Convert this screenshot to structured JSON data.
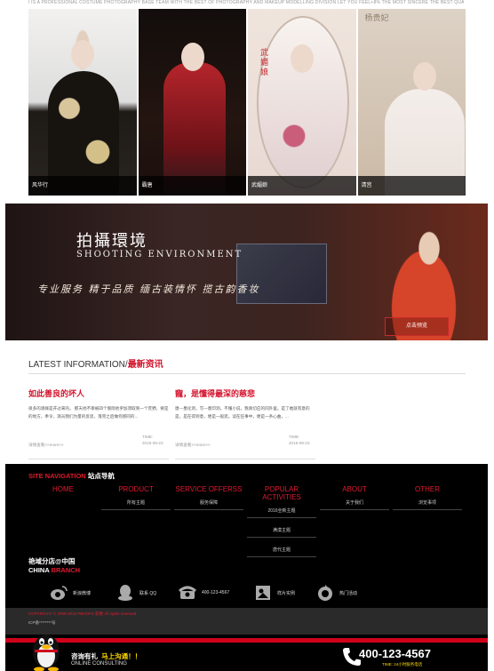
{
  "tagline": "I IS A PROFESSIONAL COSTUME PHOTOGRAPHY BASE TEAM WITH THE BEST OF PHOTOGRAPHY AND MAKEUP MODELLING DIVISION LET YOU FEEL+8% THE MOST SINCERE THE BEST QUALITY SERVICE",
  "gallery": [
    {
      "caption": "风华行",
      "overlay": ""
    },
    {
      "caption": "霸唐",
      "overlay": ""
    },
    {
      "caption": "武媚娘",
      "overlay": "武媚娘"
    },
    {
      "caption": "清宫",
      "overlay": "杨贵妃"
    }
  ],
  "banner": {
    "title_cn": "拍攝環境",
    "title_en": "SHOOTING ENVIRONMENT",
    "slogan": "专业服务  精于品质  缅古装情怀  揽古韵香妆",
    "button": "点击预览"
  },
  "latest": {
    "title_en": "LATEST INFORMATION/",
    "title_cn": "最新资讯"
  },
  "news": [
    {
      "title": "如此善良的坏人",
      "body": "很多的演绎是开过来的。 那天他不幸被四个僧陨他罗加须取到一个荒野。要是的地方，奉令，演员我们为量的反思，落完之后做何感同的...",
      "time_label": "TIME:",
      "date": "2016-09-23",
      "more": "详情查看>>more>>"
    },
    {
      "title": "寵，是懂得最深的慈悲",
      "body": "唐—墨化洞，写—墨印洞，不懂小说，我真切应的同外里。是了她就有意的是，是在得到意，便是一般逛。读在狂事中，便是一条心曲，...",
      "time_label": "TIME:",
      "date": "2016-09-23",
      "more": "详情查看>>more>>"
    }
  ],
  "footer": {
    "nav_title_en": "SITE NAVIGATION",
    "nav_title_cn": "站点导航",
    "columns": [
      {
        "head": "HOME",
        "subs": []
      },
      {
        "head": "PRODUCT",
        "subs": [
          "所有主题"
        ]
      },
      {
        "head": "SERVICE OFFERSS",
        "subs": [
          "服务保障"
        ]
      },
      {
        "head": "POPULAR ACTIVITIES",
        "subs": [
          "2016全新主题",
          "满漠主题",
          "唐代主题"
        ]
      },
      {
        "head": "ABOUT",
        "subs": [
          "关于我们"
        ]
      },
      {
        "head": "OTHER",
        "subs": [
          "浏览事项"
        ]
      }
    ],
    "branch_cn": "艳域分店@中国",
    "branch_en_white": "CHINA",
    "branch_en_red": "BRANCH",
    "icons": [
      {
        "icon": "weibo-icon",
        "label": "新浪微博"
      },
      {
        "icon": "qq-icon",
        "label": "联系 QQ"
      },
      {
        "icon": "telephone-icon",
        "label": "400-123-4567"
      },
      {
        "icon": "photo-icon",
        "label": "样片实例"
      },
      {
        "icon": "activity-icon",
        "label": "热门活动"
      }
    ],
    "copyright": "COPYRIGHT © 2009-2016 PBHOFS 影楼 All rights reserved",
    "icp": "ICP备********号",
    "consult_cn": "咨询有礼",
    "consult_hl": "马上沟通！！",
    "consult_en": "ONLINE CONSULTING",
    "phone": "400-123-4567",
    "hours": "TIME: 24小时服务电话"
  },
  "colors": {
    "accent": "#d3112a",
    "footer_bg": "#000000",
    "hotline_yellow": "#ffd800"
  }
}
